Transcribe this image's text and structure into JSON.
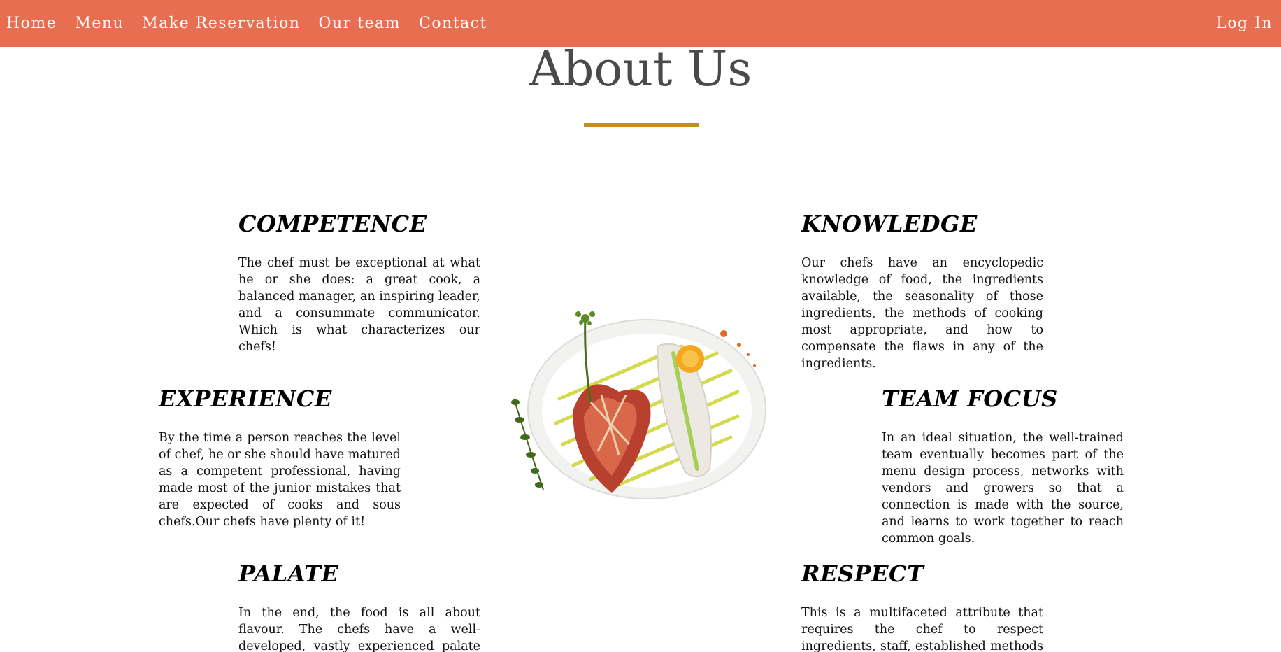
{
  "nav": {
    "items": [
      {
        "label": "Home"
      },
      {
        "label": "Menu"
      },
      {
        "label": "Make Reservation"
      },
      {
        "label": "Our team"
      },
      {
        "label": "Contact"
      }
    ],
    "login_label": "Log In"
  },
  "colors": {
    "navbar_bg": "#e86e52",
    "title_text": "#4a4a4a",
    "divider": "#c38f24"
  },
  "page": {
    "title": "About Us"
  },
  "sections": {
    "competence": {
      "heading": "COMPETENCE",
      "body": "The chef must be exceptional at what he or she does: a great cook, a balanced manager, an inspiring leader, and a consummate communicator. Which is what characterizes our chefs!"
    },
    "knowledge": {
      "heading": "KNOWLEDGE",
      "body": "Our chefs have an encyclopedic knowledge of food, the ingredients available, the seasonality of those ingredients, the methods of cooking most appropriate, and how to compensate the flaws in any of the ingredients."
    },
    "experience": {
      "heading": "EXPERIENCE",
      "body": "By the time a person reaches the level of chef, he or she should have matured as a competent professional, having made most of the junior mistakes that are expected of cooks and sous chefs.Our chefs have plenty of it!"
    },
    "teamfocus": {
      "heading": "TEAM FOCUS",
      "body": "In an ideal situation, the well-trained team eventually becomes part of the menu design process, networks with vendors and growers so that a connection is made with the source, and learns to work together to reach common goals."
    },
    "palate": {
      "heading": "PALATE",
      "body": "In the end, the food is all about flavour. The chefs have a well-developed, vastly experienced palate and the ability to"
    },
    "respect": {
      "heading": "RESPECT",
      "body": "This is a multifaceted attribute that requires the chef to respect ingredients, staff, established methods of cooking, the"
    }
  }
}
